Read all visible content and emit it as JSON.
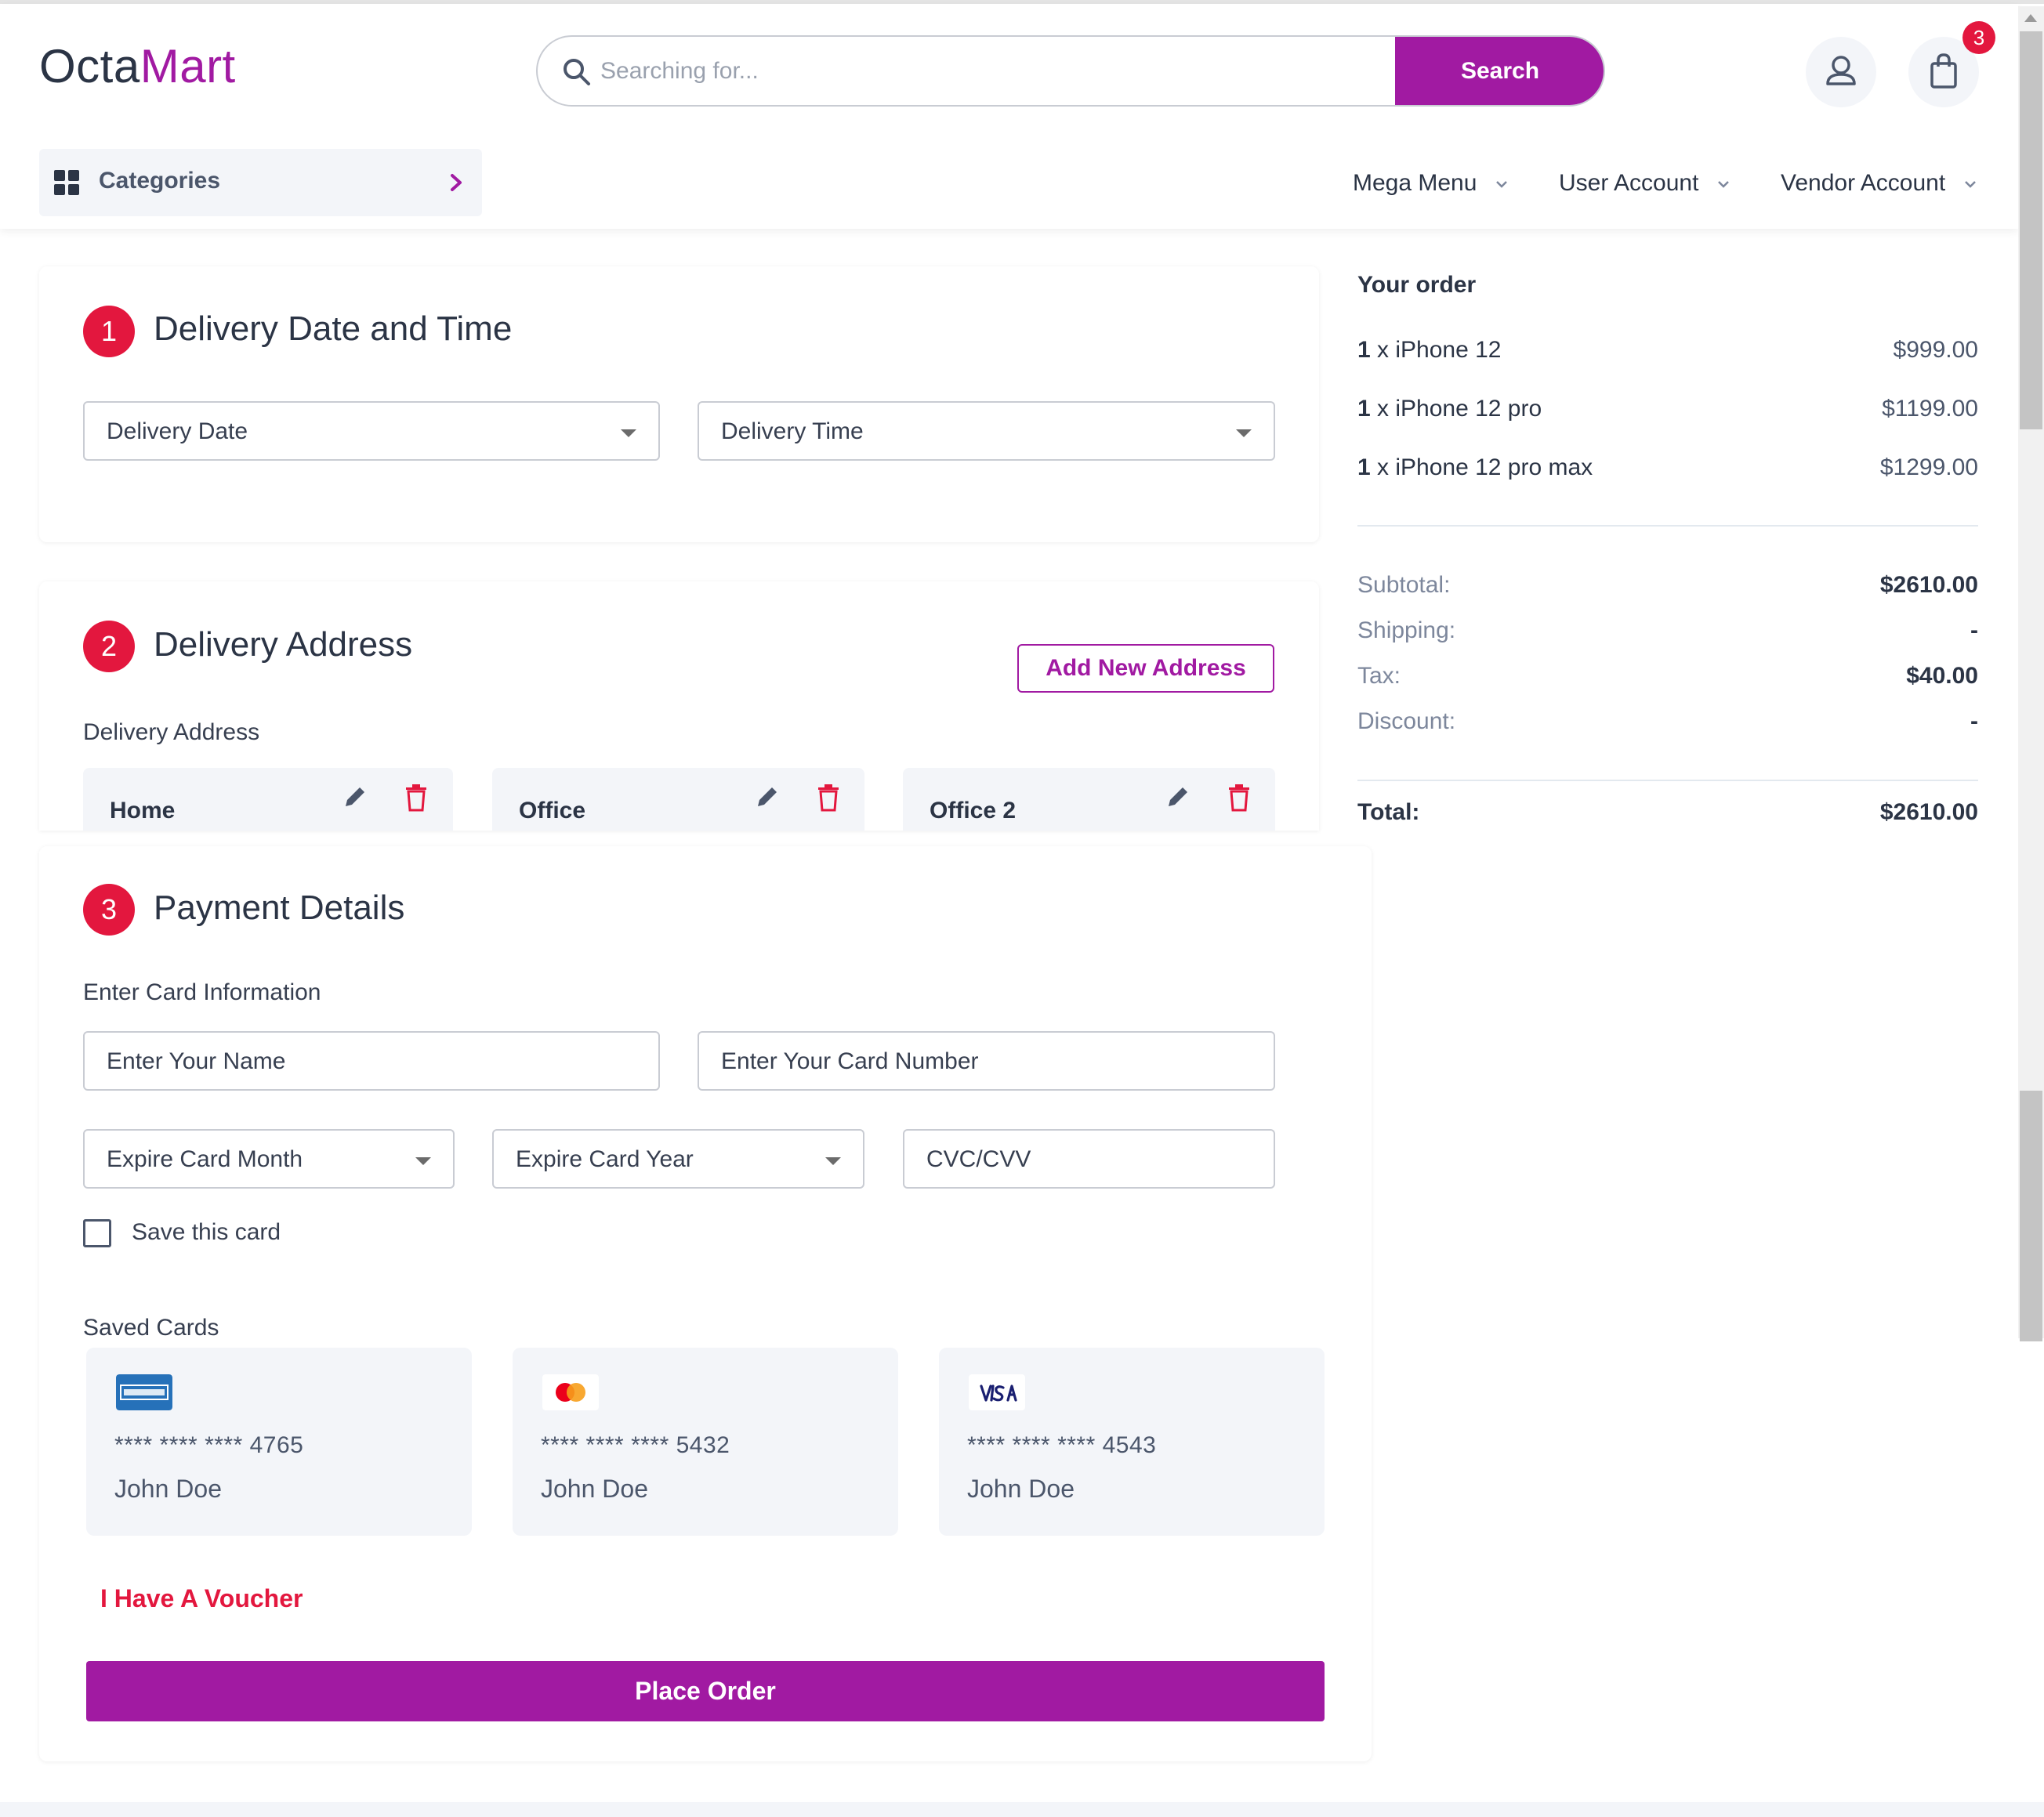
{
  "header": {
    "logo_part1": "Octa",
    "logo_part2": "Mart",
    "search_placeholder": "Searching for...",
    "search_button": "Search",
    "cart_count": "3",
    "categories_label": "Categories",
    "nav": [
      "Mega Menu",
      "User Account",
      "Vendor Account"
    ]
  },
  "delivery_time": {
    "step": "1",
    "title": "Delivery Date and Time",
    "date_select": "Delivery Date",
    "time_select": "Delivery Time"
  },
  "delivery_address": {
    "step": "2",
    "title": "Delivery Address",
    "add_button": "Add New Address",
    "label": "Delivery Address",
    "addresses": [
      "Home",
      "Office",
      "Office 2"
    ]
  },
  "payment": {
    "step": "3",
    "title": "Payment Details",
    "card_info_label": "Enter Card Information",
    "name_placeholder": "Enter Your Name",
    "card_number_placeholder": "Enter Your Card Number",
    "month_select": "Expire Card Month",
    "year_select": "Expire Card Year",
    "cvc_placeholder": "CVC/CVV",
    "save_card_label": "Save this card",
    "saved_cards_label": "Saved Cards",
    "saved_cards": [
      {
        "brand": "amex-logo",
        "number": "**** **** **** 4765",
        "holder": "John Doe"
      },
      {
        "brand": "mastercard-logo",
        "number": "**** **** **** 5432",
        "holder": "John Doe"
      },
      {
        "brand": "visa-logo",
        "number": "**** **** **** 4543",
        "holder": "John Doe"
      }
    ],
    "voucher_link": "I Have A Voucher",
    "place_order": "Place Order"
  },
  "order": {
    "title": "Your order",
    "items": [
      {
        "qty": "1",
        "name": " x iPhone 12",
        "price": "$999.00"
      },
      {
        "qty": "1",
        "name": " x iPhone 12 pro",
        "price": "$1199.00"
      },
      {
        "qty": "1",
        "name": " x iPhone 12 pro max",
        "price": "$1299.00"
      }
    ],
    "subtotal_label": "Subtotal:",
    "subtotal": "$2610.00",
    "shipping_label": "Shipping:",
    "shipping": "-",
    "tax_label": "Tax:",
    "tax": "$40.00",
    "discount_label": "Discount:",
    "discount": "-",
    "total_label": "Total:",
    "total": "$2610.00"
  },
  "colors": {
    "brand": "#a11aa2",
    "badge": "#e3173e",
    "text": "#2b3445"
  }
}
